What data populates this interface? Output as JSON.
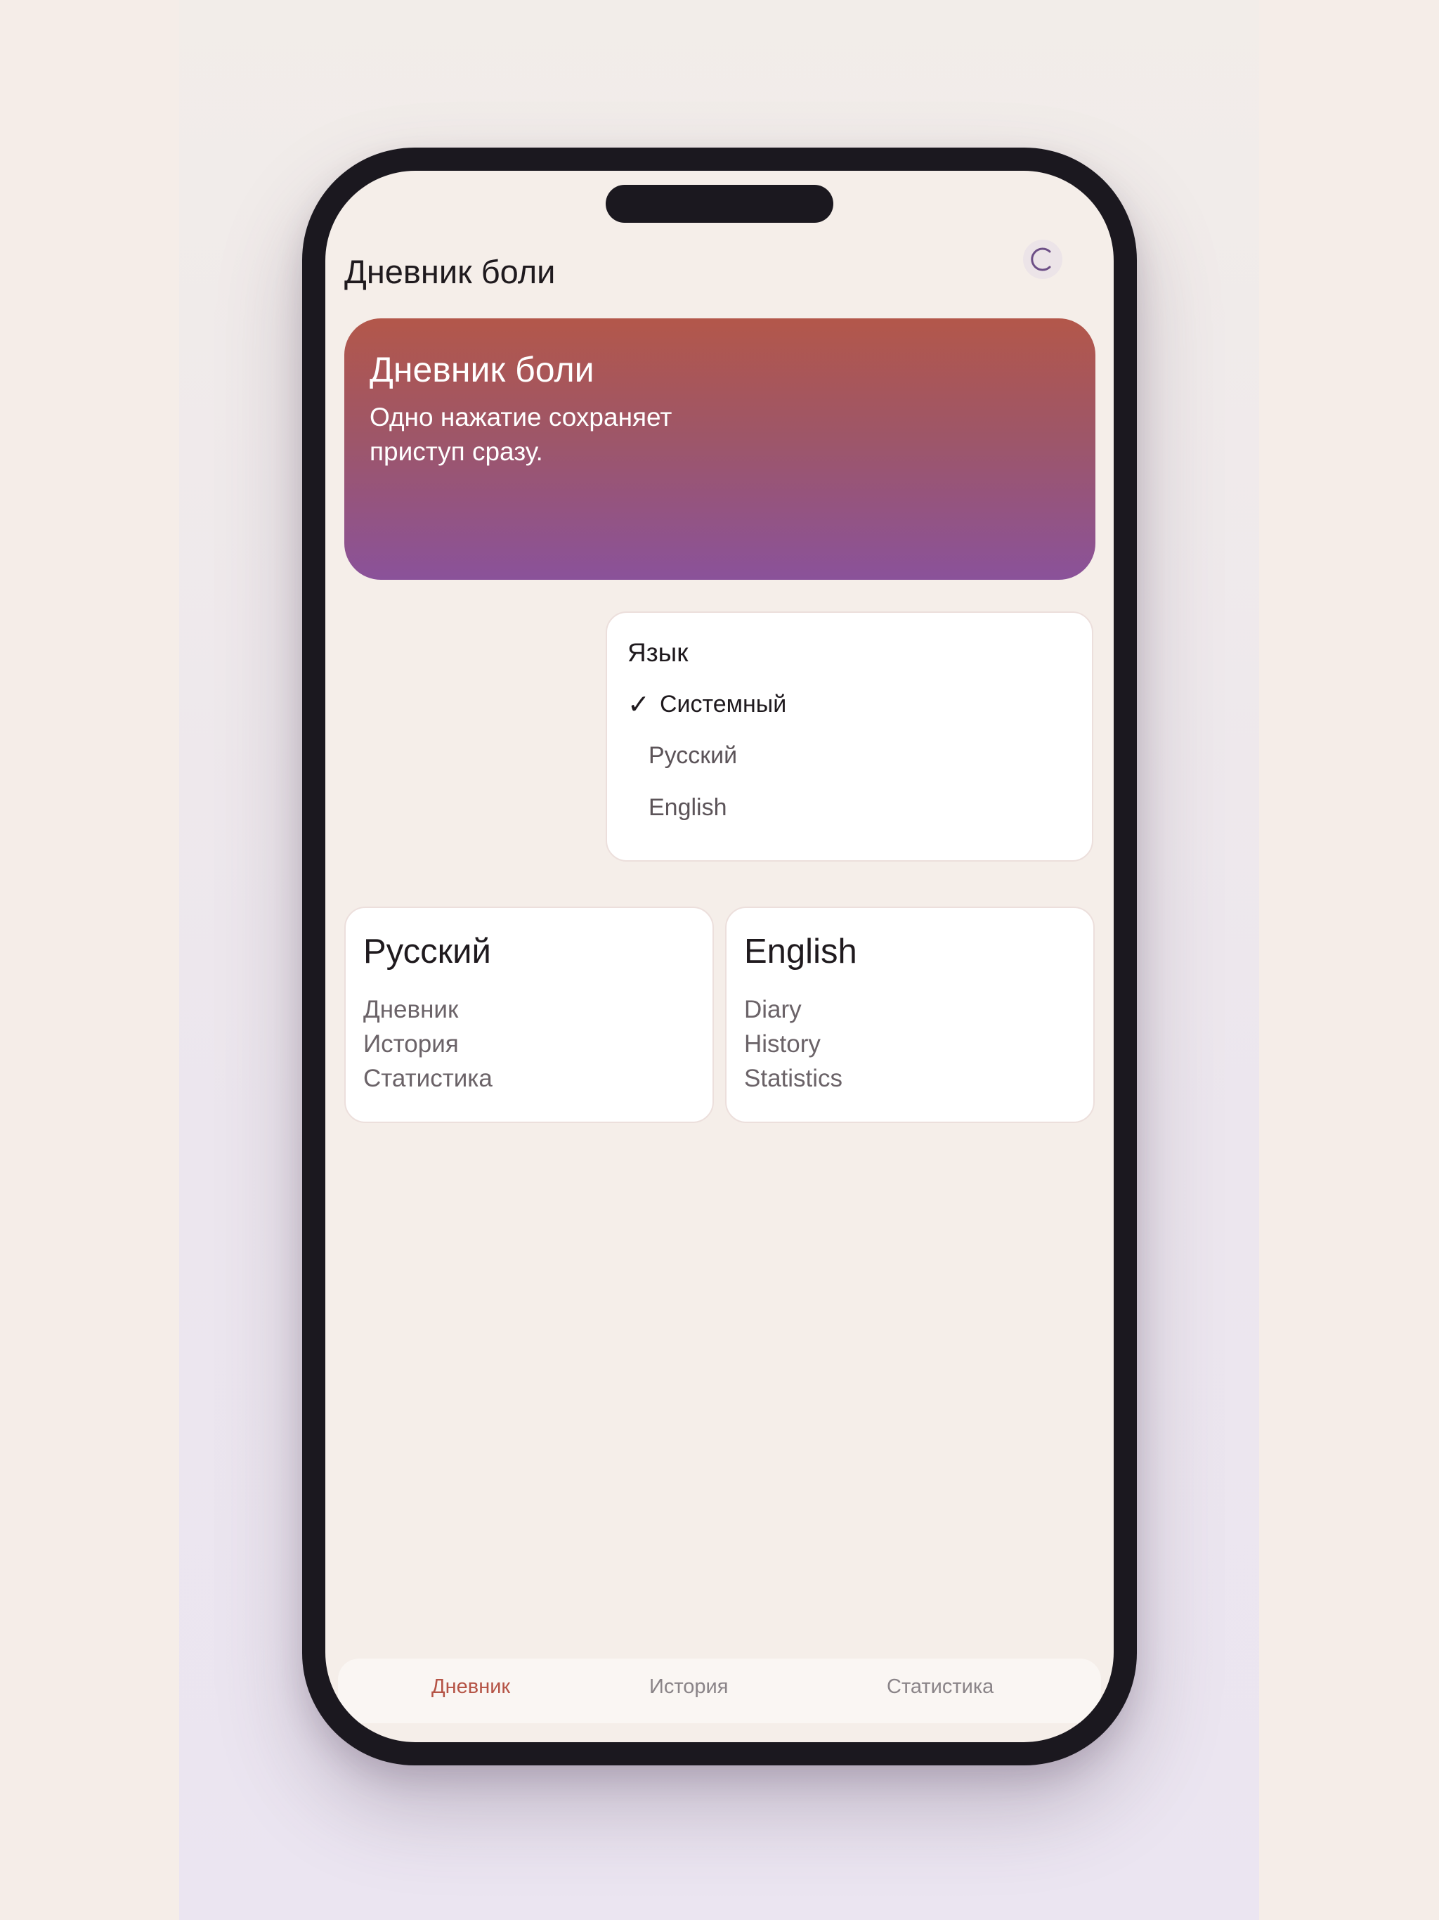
{
  "header": {
    "title": "Дневник боли"
  },
  "hero": {
    "title": "Дневник боли",
    "subtitle": "Одно нажатие сохраняет приступ сразу."
  },
  "language_menu": {
    "title": "Язык",
    "options": [
      {
        "label": "Системный",
        "selected": true
      },
      {
        "label": "Русский",
        "selected": false
      },
      {
        "label": "English",
        "selected": false
      }
    ],
    "check_mark": "✓"
  },
  "preview_cards": [
    {
      "title": "Русский",
      "items": [
        "Дневник",
        "История",
        "Статистика"
      ]
    },
    {
      "title": "English",
      "items": [
        "Diary",
        "History",
        "Statistics"
      ]
    }
  ],
  "tabbar": {
    "tabs": [
      {
        "label": "Дневник",
        "active": true
      },
      {
        "label": "История",
        "active": false
      },
      {
        "label": "Статистика",
        "active": false
      }
    ]
  },
  "colors": {
    "accent": "#b55446",
    "hero_top": "#b3574a",
    "hero_bottom": "#8a529a",
    "phone_frame": "#1b181f",
    "screen_bg": "#f5eee9"
  },
  "icons": {
    "refresh": "refresh-icon"
  }
}
